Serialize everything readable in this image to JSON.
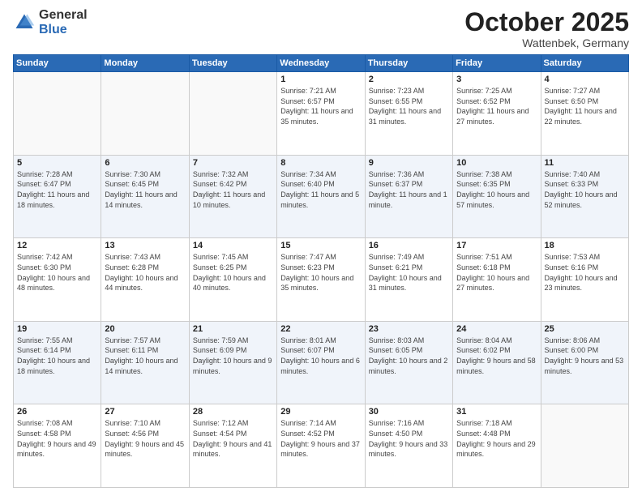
{
  "header": {
    "logo_general": "General",
    "logo_blue": "Blue",
    "month_title": "October 2025",
    "location": "Wattenbek, Germany"
  },
  "days_of_week": [
    "Sunday",
    "Monday",
    "Tuesday",
    "Wednesday",
    "Thursday",
    "Friday",
    "Saturday"
  ],
  "weeks": [
    [
      {
        "day": "",
        "sunrise": "",
        "sunset": "",
        "daylight": ""
      },
      {
        "day": "",
        "sunrise": "",
        "sunset": "",
        "daylight": ""
      },
      {
        "day": "",
        "sunrise": "",
        "sunset": "",
        "daylight": ""
      },
      {
        "day": "1",
        "sunrise": "Sunrise: 7:21 AM",
        "sunset": "Sunset: 6:57 PM",
        "daylight": "Daylight: 11 hours and 35 minutes."
      },
      {
        "day": "2",
        "sunrise": "Sunrise: 7:23 AM",
        "sunset": "Sunset: 6:55 PM",
        "daylight": "Daylight: 11 hours and 31 minutes."
      },
      {
        "day": "3",
        "sunrise": "Sunrise: 7:25 AM",
        "sunset": "Sunset: 6:52 PM",
        "daylight": "Daylight: 11 hours and 27 minutes."
      },
      {
        "day": "4",
        "sunrise": "Sunrise: 7:27 AM",
        "sunset": "Sunset: 6:50 PM",
        "daylight": "Daylight: 11 hours and 22 minutes."
      }
    ],
    [
      {
        "day": "5",
        "sunrise": "Sunrise: 7:28 AM",
        "sunset": "Sunset: 6:47 PM",
        "daylight": "Daylight: 11 hours and 18 minutes."
      },
      {
        "day": "6",
        "sunrise": "Sunrise: 7:30 AM",
        "sunset": "Sunset: 6:45 PM",
        "daylight": "Daylight: 11 hours and 14 minutes."
      },
      {
        "day": "7",
        "sunrise": "Sunrise: 7:32 AM",
        "sunset": "Sunset: 6:42 PM",
        "daylight": "Daylight: 11 hours and 10 minutes."
      },
      {
        "day": "8",
        "sunrise": "Sunrise: 7:34 AM",
        "sunset": "Sunset: 6:40 PM",
        "daylight": "Daylight: 11 hours and 5 minutes."
      },
      {
        "day": "9",
        "sunrise": "Sunrise: 7:36 AM",
        "sunset": "Sunset: 6:37 PM",
        "daylight": "Daylight: 11 hours and 1 minute."
      },
      {
        "day": "10",
        "sunrise": "Sunrise: 7:38 AM",
        "sunset": "Sunset: 6:35 PM",
        "daylight": "Daylight: 10 hours and 57 minutes."
      },
      {
        "day": "11",
        "sunrise": "Sunrise: 7:40 AM",
        "sunset": "Sunset: 6:33 PM",
        "daylight": "Daylight: 10 hours and 52 minutes."
      }
    ],
    [
      {
        "day": "12",
        "sunrise": "Sunrise: 7:42 AM",
        "sunset": "Sunset: 6:30 PM",
        "daylight": "Daylight: 10 hours and 48 minutes."
      },
      {
        "day": "13",
        "sunrise": "Sunrise: 7:43 AM",
        "sunset": "Sunset: 6:28 PM",
        "daylight": "Daylight: 10 hours and 44 minutes."
      },
      {
        "day": "14",
        "sunrise": "Sunrise: 7:45 AM",
        "sunset": "Sunset: 6:25 PM",
        "daylight": "Daylight: 10 hours and 40 minutes."
      },
      {
        "day": "15",
        "sunrise": "Sunrise: 7:47 AM",
        "sunset": "Sunset: 6:23 PM",
        "daylight": "Daylight: 10 hours and 35 minutes."
      },
      {
        "day": "16",
        "sunrise": "Sunrise: 7:49 AM",
        "sunset": "Sunset: 6:21 PM",
        "daylight": "Daylight: 10 hours and 31 minutes."
      },
      {
        "day": "17",
        "sunrise": "Sunrise: 7:51 AM",
        "sunset": "Sunset: 6:18 PM",
        "daylight": "Daylight: 10 hours and 27 minutes."
      },
      {
        "day": "18",
        "sunrise": "Sunrise: 7:53 AM",
        "sunset": "Sunset: 6:16 PM",
        "daylight": "Daylight: 10 hours and 23 minutes."
      }
    ],
    [
      {
        "day": "19",
        "sunrise": "Sunrise: 7:55 AM",
        "sunset": "Sunset: 6:14 PM",
        "daylight": "Daylight: 10 hours and 18 minutes."
      },
      {
        "day": "20",
        "sunrise": "Sunrise: 7:57 AM",
        "sunset": "Sunset: 6:11 PM",
        "daylight": "Daylight: 10 hours and 14 minutes."
      },
      {
        "day": "21",
        "sunrise": "Sunrise: 7:59 AM",
        "sunset": "Sunset: 6:09 PM",
        "daylight": "Daylight: 10 hours and 9 minutes."
      },
      {
        "day": "22",
        "sunrise": "Sunrise: 8:01 AM",
        "sunset": "Sunset: 6:07 PM",
        "daylight": "Daylight: 10 hours and 6 minutes."
      },
      {
        "day": "23",
        "sunrise": "Sunrise: 8:03 AM",
        "sunset": "Sunset: 6:05 PM",
        "daylight": "Daylight: 10 hours and 2 minutes."
      },
      {
        "day": "24",
        "sunrise": "Sunrise: 8:04 AM",
        "sunset": "Sunset: 6:02 PM",
        "daylight": "Daylight: 9 hours and 58 minutes."
      },
      {
        "day": "25",
        "sunrise": "Sunrise: 8:06 AM",
        "sunset": "Sunset: 6:00 PM",
        "daylight": "Daylight: 9 hours and 53 minutes."
      }
    ],
    [
      {
        "day": "26",
        "sunrise": "Sunrise: 7:08 AM",
        "sunset": "Sunset: 4:58 PM",
        "daylight": "Daylight: 9 hours and 49 minutes."
      },
      {
        "day": "27",
        "sunrise": "Sunrise: 7:10 AM",
        "sunset": "Sunset: 4:56 PM",
        "daylight": "Daylight: 9 hours and 45 minutes."
      },
      {
        "day": "28",
        "sunrise": "Sunrise: 7:12 AM",
        "sunset": "Sunset: 4:54 PM",
        "daylight": "Daylight: 9 hours and 41 minutes."
      },
      {
        "day": "29",
        "sunrise": "Sunrise: 7:14 AM",
        "sunset": "Sunset: 4:52 PM",
        "daylight": "Daylight: 9 hours and 37 minutes."
      },
      {
        "day": "30",
        "sunrise": "Sunrise: 7:16 AM",
        "sunset": "Sunset: 4:50 PM",
        "daylight": "Daylight: 9 hours and 33 minutes."
      },
      {
        "day": "31",
        "sunrise": "Sunrise: 7:18 AM",
        "sunset": "Sunset: 4:48 PM",
        "daylight": "Daylight: 9 hours and 29 minutes."
      },
      {
        "day": "",
        "sunrise": "",
        "sunset": "",
        "daylight": ""
      }
    ]
  ]
}
